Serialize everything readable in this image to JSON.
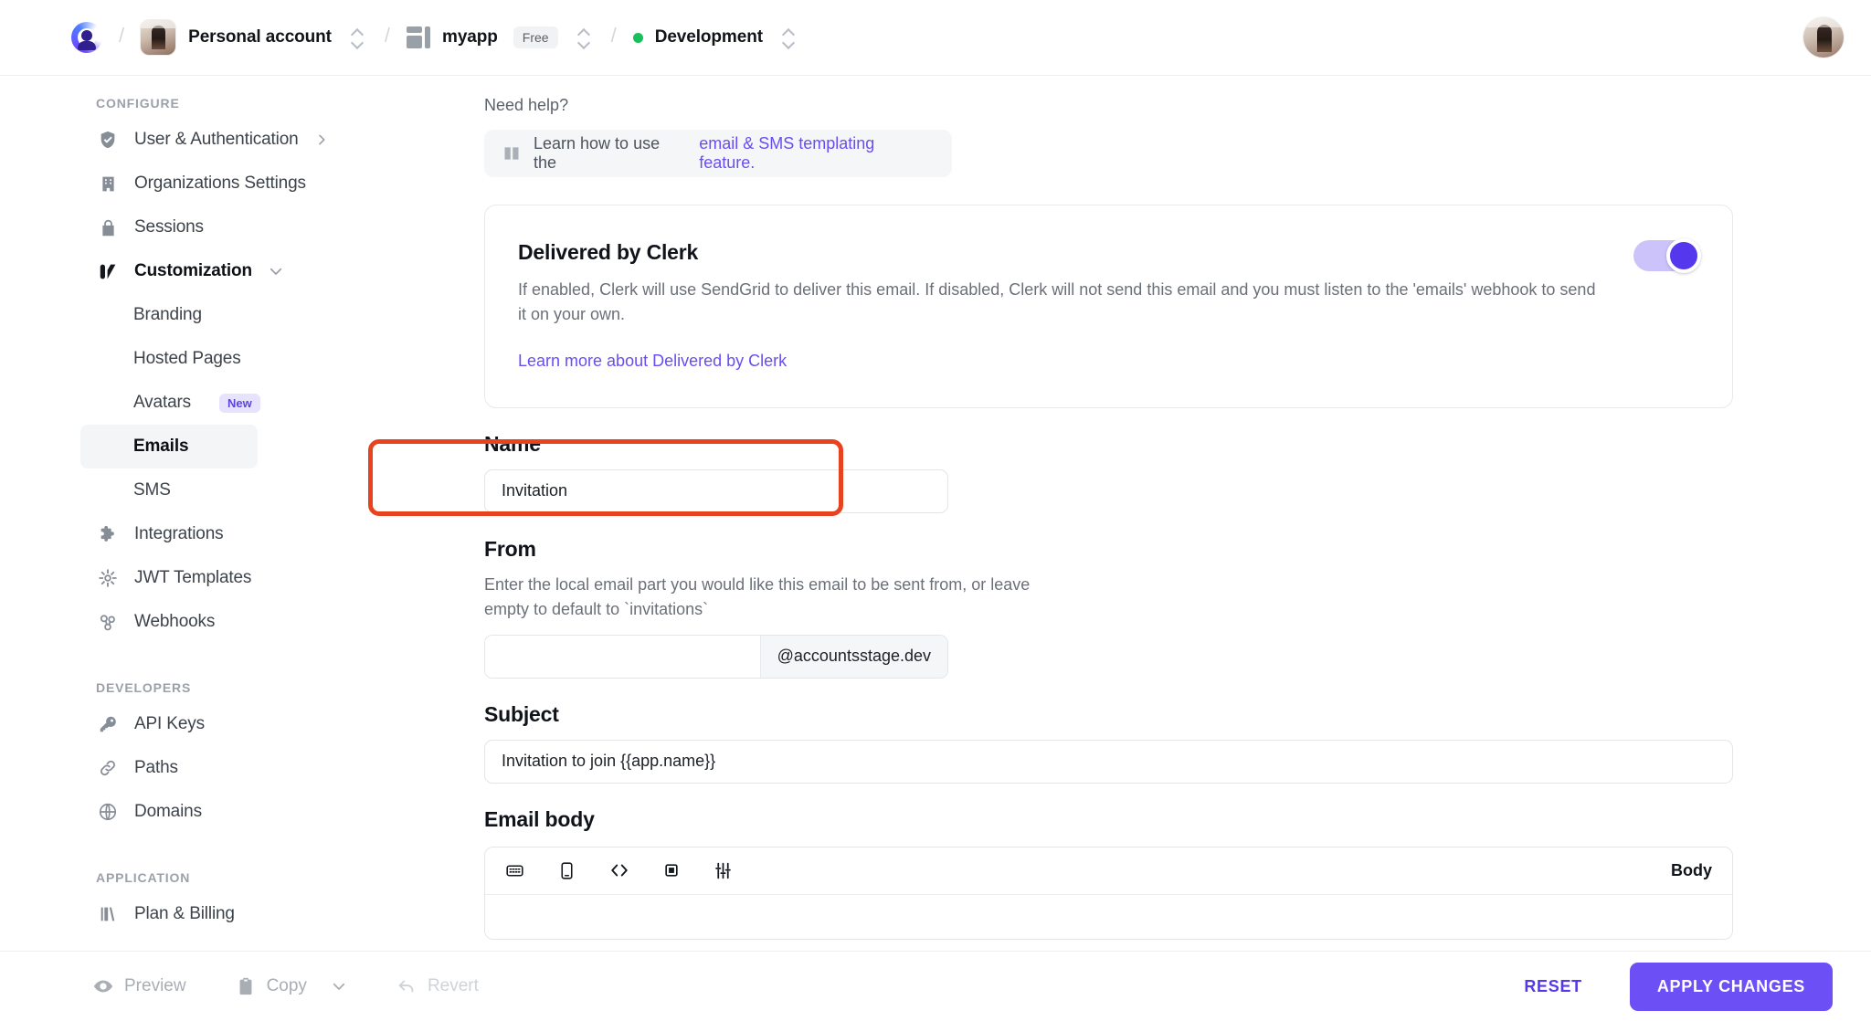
{
  "topbar": {
    "logo_icon": "clerk-logo-icon",
    "account": {
      "name": "Personal account",
      "avatar": "user-avatar-image"
    },
    "app": {
      "name": "myapp",
      "plan_badge": "Free",
      "icon": "app-grid-icon"
    },
    "environment": {
      "name": "Development",
      "status_color": "#18bf5a"
    },
    "user_avatar": "profile-avatar-image",
    "separator": "/"
  },
  "sidebar": {
    "sections": [
      {
        "label": "CONFIGURE",
        "items": [
          {
            "label": "User & Authentication",
            "icon": "shield-check-icon",
            "chevron": "right"
          },
          {
            "label": "Organizations Settings",
            "icon": "building-icon"
          },
          {
            "label": "Sessions",
            "icon": "lock-icon"
          },
          {
            "label": "Customization",
            "icon": "customization-icon",
            "chevron": "down",
            "expanded": true,
            "strong": true
          },
          {
            "label": "Branding",
            "sub": true
          },
          {
            "label": "Hosted Pages",
            "sub": true
          },
          {
            "label": "Avatars",
            "sub": true,
            "badge": "New"
          },
          {
            "label": "Emails",
            "sub": true,
            "active": true
          },
          {
            "label": "SMS",
            "sub": true
          },
          {
            "label": "Integrations",
            "icon": "puzzle-icon"
          },
          {
            "label": "JWT Templates",
            "icon": "asterisk-icon"
          },
          {
            "label": "Webhooks",
            "icon": "webhook-icon"
          }
        ]
      },
      {
        "label": "DEVELOPERS",
        "items": [
          {
            "label": "API Keys",
            "icon": "key-icon"
          },
          {
            "label": "Paths",
            "icon": "link-icon"
          },
          {
            "label": "Domains",
            "icon": "globe-icon"
          }
        ]
      },
      {
        "label": "APPLICATION",
        "items": [
          {
            "label": "Plan & Billing",
            "icon": "billing-icon"
          }
        ]
      }
    ]
  },
  "main": {
    "need_help_label": "Need help?",
    "help_banner": {
      "icon": "book-icon",
      "text_prefix": "Learn how to use the ",
      "link_text": "email & SMS templating feature.",
      "link_color": "#6a4df0"
    },
    "delivered_card": {
      "title": "Delivered by Clerk",
      "description": "If enabled, Clerk will use SendGrid to deliver this email. If disabled, Clerk will not send this email and you must listen to the 'emails' webhook to send it on your own.",
      "link_text": "Learn more about Delivered by Clerk",
      "toggle_on": true,
      "toggle_color": "#5538ee"
    },
    "name_field": {
      "label": "Name",
      "value": "Invitation",
      "placeholder": ""
    },
    "from_field": {
      "label": "From",
      "help": "Enter the local email part you would like this email to be sent from, or leave empty to default to `invitations`",
      "value": "",
      "placeholder": "",
      "suffix": "@accountsstage.dev"
    },
    "subject_field": {
      "label": "Subject",
      "value": "Invitation to join {{app.name}}",
      "placeholder": ""
    },
    "email_body": {
      "label": "Email body",
      "toolbar_icons": [
        "desktop-preview-icon",
        "mobile-preview-icon",
        "code-icon",
        "square-icon",
        "sliders-icon"
      ],
      "right_label": "Body"
    },
    "annotation": {
      "color": "#e8431f",
      "target": "name-field-group"
    }
  },
  "bottombar": {
    "preview_label": "Preview",
    "preview_icon": "eye-icon",
    "copy_label": "Copy",
    "copy_icon": "clipboard-icon",
    "copy_chevron": "chevron-down-icon",
    "revert_label": "Revert",
    "revert_icon": "undo-arrow-icon",
    "reset_label": "RESET",
    "apply_label": "APPLY CHANGES",
    "apply_color": "#6c4ff5"
  }
}
